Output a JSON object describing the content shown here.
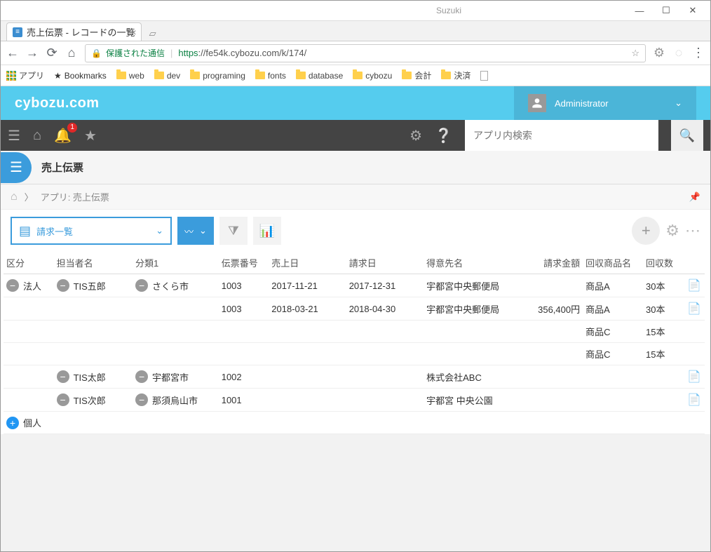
{
  "window": {
    "owner": "Suzuki"
  },
  "browser": {
    "tab_title": "売上伝票 - レコードの一覧",
    "secure_label": "保護された通信",
    "url_https": "https",
    "url_rest": "://fe54k.cybozu.com/k/174/",
    "bookmarks": {
      "apps_label": "アプリ",
      "bookmarks_label": "Bookmarks",
      "items": [
        "web",
        "dev",
        "programing",
        "fonts",
        "database",
        "cybozu",
        "会計",
        "決済"
      ]
    }
  },
  "header": {
    "logo": "cybozu.com",
    "user": "Administrator",
    "notif_count": "1",
    "search_placeholder": "アプリ内検索"
  },
  "app": {
    "title": "売上伝票",
    "breadcrumb_prefix": "アプリ: ",
    "breadcrumb_name": "売上伝票",
    "view_name": "請求一覧"
  },
  "columns": [
    "区分",
    "担当者名",
    "分類1",
    "伝票番号",
    "売上日",
    "請求日",
    "得意先名",
    "請求金額",
    "回収商品名",
    "回収数"
  ],
  "groups": [
    {
      "kubun": "法人",
      "expand": "minus",
      "persons": [
        {
          "name": "TIS五郎",
          "class1": "さくら市",
          "rows": [
            {
              "no": "1003",
              "sale": "2017-11-21",
              "bill": "2017-12-31",
              "cust": "宇都宮中央郵便局",
              "amount": "",
              "item": "商品A",
              "qty": "30本"
            },
            {
              "no": "1003",
              "sale": "2018-03-21",
              "bill": "2018-04-30",
              "cust": "宇都宮中央郵便局",
              "amount": "356,400円",
              "item": "商品A",
              "qty": "30本"
            },
            {
              "no": "",
              "sale": "",
              "bill": "",
              "cust": "",
              "amount": "",
              "item": "商品C",
              "qty": "15本"
            },
            {
              "no": "",
              "sale": "",
              "bill": "",
              "cust": "",
              "amount": "",
              "item": "商品C",
              "qty": "15本"
            }
          ]
        },
        {
          "name": "TIS太郎",
          "class1": "宇都宮市",
          "rows": [
            {
              "no": "1002",
              "sale": "",
              "bill": "",
              "cust": "株式会社ABC",
              "amount": "",
              "item": "",
              "qty": ""
            }
          ]
        },
        {
          "name": "TIS次郎",
          "class1": "那須烏山市",
          "rows": [
            {
              "no": "1001",
              "sale": "",
              "bill": "",
              "cust": "宇都宮 中央公園",
              "amount": "",
              "item": "",
              "qty": ""
            }
          ]
        }
      ]
    },
    {
      "kubun": "個人",
      "expand": "plus",
      "persons": []
    }
  ]
}
